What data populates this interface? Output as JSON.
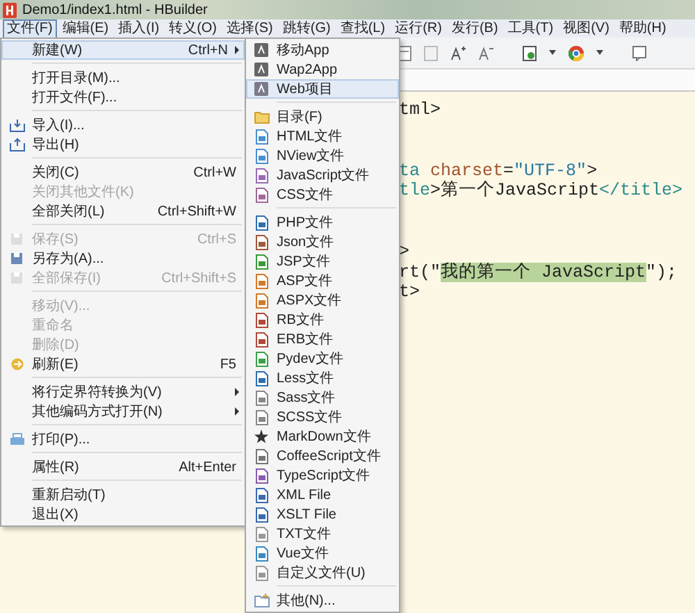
{
  "window": {
    "title": "Demo1/index1.html  -  HBuilder"
  },
  "menubar": [
    {
      "label": "文件(F)",
      "selected": true
    },
    {
      "label": "编辑(E)",
      "selected": false
    },
    {
      "label": "插入(I)",
      "selected": false
    },
    {
      "label": "转义(O)",
      "selected": false
    },
    {
      "label": "选择(S)",
      "selected": false
    },
    {
      "label": "跳转(G)",
      "selected": false
    },
    {
      "label": "查找(L)",
      "selected": false
    },
    {
      "label": "运行(R)",
      "selected": false
    },
    {
      "label": "发行(B)",
      "selected": false
    },
    {
      "label": "工具(T)",
      "selected": false
    },
    {
      "label": "视图(V)",
      "selected": false
    },
    {
      "label": "帮助(H)",
      "selected": false
    }
  ],
  "file_menu": [
    [
      {
        "label": "新建(W)",
        "shortcut": "Ctrl+N",
        "submenu": true,
        "selected": true,
        "disabled": false
      }
    ],
    [
      {
        "label": "打开目录(M)...",
        "selected": false,
        "disabled": false
      },
      {
        "label": "打开文件(F)...",
        "selected": false,
        "disabled": false
      }
    ],
    [
      {
        "label": "导入(I)...",
        "selected": false,
        "disabled": false
      },
      {
        "label": "导出(H)",
        "selected": false,
        "disabled": false
      }
    ],
    [
      {
        "label": "关闭(C)",
        "shortcut": "Ctrl+W",
        "selected": false,
        "disabled": false
      },
      {
        "label": "关闭其他文件(K)",
        "selected": false,
        "disabled": true
      },
      {
        "label": "全部关闭(L)",
        "shortcut": "Ctrl+Shift+W",
        "selected": false,
        "disabled": false
      }
    ],
    [
      {
        "label": "保存(S)",
        "shortcut": "Ctrl+S",
        "selected": false,
        "disabled": true
      },
      {
        "label": "另存为(A)...",
        "selected": false,
        "disabled": false
      },
      {
        "label": "全部保存(I)",
        "shortcut": "Ctrl+Shift+S",
        "selected": false,
        "disabled": true
      }
    ],
    [
      {
        "label": "移动(V)...",
        "selected": false,
        "disabled": true
      },
      {
        "label": "重命名",
        "selected": false,
        "disabled": true
      },
      {
        "label": "删除(D)",
        "selected": false,
        "disabled": true
      },
      {
        "label": "刷新(E)",
        "shortcut": "F5",
        "selected": false,
        "disabled": false
      }
    ],
    [
      {
        "label": "将行定界符转换为(V)",
        "submenu": true,
        "selected": false,
        "disabled": false
      },
      {
        "label": "其他编码方式打开(N)",
        "submenu": true,
        "selected": false,
        "disabled": false
      }
    ],
    [
      {
        "label": "打印(P)...",
        "selected": false,
        "disabled": false
      }
    ],
    [
      {
        "label": "属性(R)",
        "shortcut": "Alt+Enter",
        "selected": false,
        "disabled": false
      }
    ],
    [
      {
        "label": "重新启动(T)",
        "selected": false,
        "disabled": false
      },
      {
        "label": "退出(X)",
        "selected": false,
        "disabled": false
      }
    ]
  ],
  "new_submenu": [
    [
      {
        "label": "移动App",
        "selected": false
      },
      {
        "label": "Wap2App",
        "selected": false
      },
      {
        "label": "Web项目",
        "selected": true
      }
    ],
    [
      {
        "label": "目录(F)",
        "selected": false
      },
      {
        "label": "HTML文件",
        "selected": false
      },
      {
        "label": "NView文件",
        "selected": false
      },
      {
        "label": "JavaScript文件",
        "selected": false
      },
      {
        "label": "CSS文件",
        "selected": false
      }
    ],
    [
      {
        "label": "PHP文件",
        "selected": false
      },
      {
        "label": "Json文件",
        "selected": false
      },
      {
        "label": "JSP文件",
        "selected": false
      },
      {
        "label": "ASP文件",
        "selected": false
      },
      {
        "label": "ASPX文件",
        "selected": false
      },
      {
        "label": "RB文件",
        "selected": false
      },
      {
        "label": "ERB文件",
        "selected": false
      },
      {
        "label": "Pydev文件",
        "selected": false
      },
      {
        "label": "Less文件",
        "selected": false
      },
      {
        "label": "Sass文件",
        "selected": false
      },
      {
        "label": "SCSS文件",
        "selected": false
      },
      {
        "label": "MarkDown文件",
        "selected": false
      },
      {
        "label": "CoffeeScript文件",
        "selected": false
      },
      {
        "label": "TypeScript文件",
        "selected": false
      },
      {
        "label": "XML File",
        "selected": false
      },
      {
        "label": "XSLT File",
        "selected": false
      },
      {
        "label": "TXT文件",
        "selected": false
      },
      {
        "label": "Vue文件",
        "selected": false
      },
      {
        "label": "自定义文件(U)",
        "selected": false
      }
    ],
    [
      {
        "label": "其他(N)...",
        "selected": false
      }
    ]
  ],
  "editor": {
    "lines": [
      {
        "segments": [
          {
            "kind": "plain",
            "text": "tml>"
          }
        ]
      },
      {
        "segments": [
          {
            "kind": "tag",
            "text": "ta "
          },
          {
            "kind": "attr",
            "text": "charset"
          },
          {
            "kind": "plain",
            "text": "="
          },
          {
            "kind": "string",
            "text": "\"UTF-8\""
          },
          {
            "kind": "plain",
            "text": ">"
          }
        ]
      },
      {
        "segments": [
          {
            "kind": "tag",
            "text": "tle"
          },
          {
            "kind": "plain",
            "text": ">第一个JavaScript"
          },
          {
            "kind": "tag",
            "text": "</title>"
          }
        ]
      },
      {
        "segments": [
          {
            "kind": "plain",
            "text": ">"
          }
        ]
      },
      {
        "segments": [
          {
            "kind": "plain",
            "text": "rt(\""
          },
          {
            "kind": "marked",
            "text": "我的第一个 JavaScript"
          },
          {
            "kind": "plain",
            "text": "\");"
          }
        ]
      },
      {
        "segments": [
          {
            "kind": "plain",
            "text": "t>"
          }
        ]
      }
    ]
  }
}
